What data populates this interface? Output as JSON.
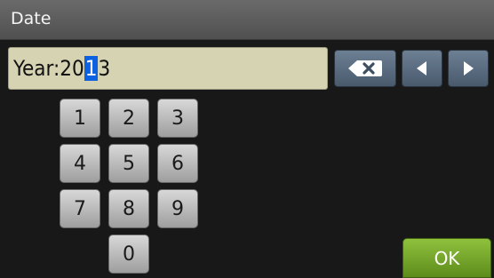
{
  "window": {
    "title": "Date"
  },
  "input": {
    "label": "Year:",
    "value_before": "20",
    "value_cursor": "1",
    "value_after": "3"
  },
  "icons": {
    "backspace": "backspace-icon",
    "left": "arrow-left-icon",
    "right": "arrow-right-icon"
  },
  "keypad": {
    "key_1": "1",
    "key_2": "2",
    "key_3": "3",
    "key_4": "4",
    "key_5": "5",
    "key_6": "6",
    "key_7": "7",
    "key_8": "8",
    "key_9": "9",
    "key_0": "0"
  },
  "actions": {
    "ok_label": "OK"
  },
  "colors": {
    "cursor": "#0c62e0",
    "ok": "#76a82b",
    "nav": "#5b6c80",
    "field": "#d6d3b3"
  }
}
